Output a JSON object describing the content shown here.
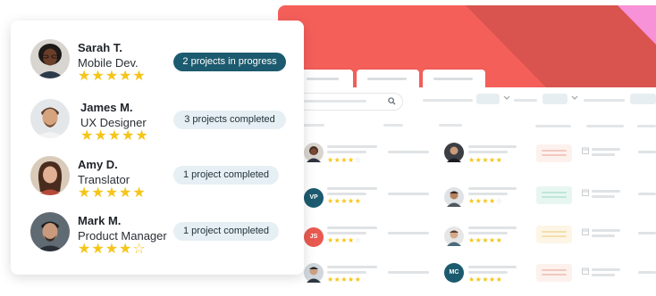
{
  "colors": {
    "banner_coral": "#f55f5a",
    "banner_dark": "#d9534f",
    "banner_pink": "#f791d8",
    "badge_active_bg": "#1c5b6f",
    "badge_bg": "#e6eff3",
    "star": "#f5c518"
  },
  "icons": {
    "search": "search-icon",
    "chevron": "chevron-down-icon",
    "calendar": "calendar-icon"
  },
  "profiles": [
    {
      "name": "Sarah T.",
      "role": "Mobile Dev.",
      "rating": 5,
      "stars": "★★★★★",
      "stars_off": "",
      "status": "2 projects in progress"
    },
    {
      "name": "James M.",
      "role": "UX Designer",
      "rating": 5,
      "stars": "★★★★★",
      "stars_off": "",
      "status": "3 projects completed"
    },
    {
      "name": "Amy D.",
      "role": "Translator",
      "rating": 5,
      "stars": "★★★★★",
      "stars_off": "",
      "status": "1 project completed"
    },
    {
      "name": "Mark M.",
      "role": "Product Manager",
      "rating": 4,
      "stars": "★★★★",
      "stars_off": "☆",
      "status": "1 project completed"
    }
  ],
  "grid_initials": {
    "vp": "VP",
    "js": "JS",
    "mc": "MC"
  },
  "grid_ratings": [
    "★★★★",
    "★★★★★",
    "★★★★★",
    "★★★★",
    "★★★★",
    "★★★★★",
    "★★★★★",
    "★★★★★"
  ]
}
